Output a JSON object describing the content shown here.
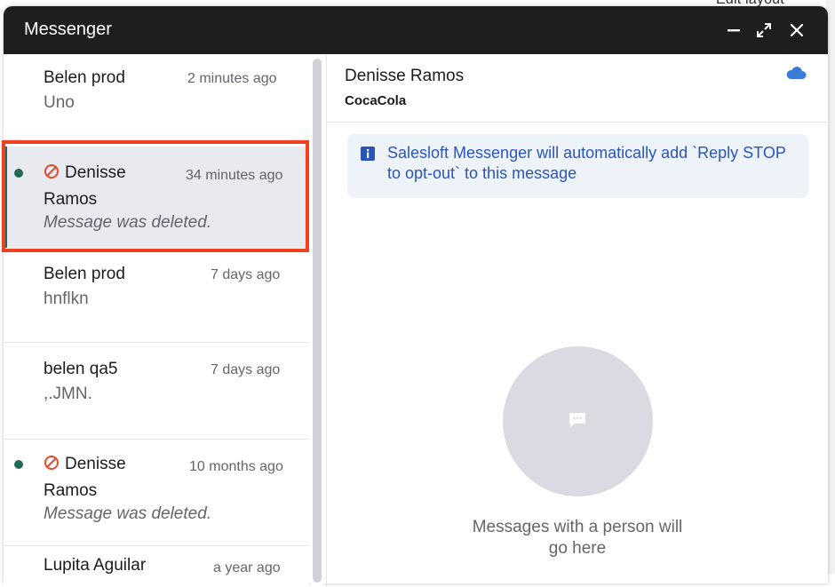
{
  "background": {
    "peek_text": "Edit layout"
  },
  "window": {
    "title": "Messenger"
  },
  "conversations": [
    {
      "name": "Belen prod",
      "time": "2 minutes ago",
      "preview": "Uno"
    },
    {
      "name": "Denisse Ramos",
      "time": "34 minutes ago",
      "preview": "Message was deleted.",
      "unread": true,
      "opted_out": true,
      "selected": true
    },
    {
      "name": "Belen prod",
      "time": "7 days ago",
      "preview": "hnflkn"
    },
    {
      "name": "belen qa5",
      "time": "7 days ago",
      "preview": ",.JMN."
    },
    {
      "name": "Denisse Ramos",
      "time": "10 months ago",
      "preview": "Message was deleted.",
      "unread": true,
      "opted_out": true
    },
    {
      "name": "Lupita Aguilar",
      "time": "a year ago"
    }
  ],
  "detail": {
    "name": "Denisse Ramos",
    "company": "CocaCola",
    "notice": "Salesloft Messenger will automatically add `Reply STOP to opt-out` to this message",
    "empty_state": "Messages with a person will go here"
  },
  "colors": {
    "accent": "#236857",
    "highlight": "#f0401d",
    "notice_text": "#2a55b8",
    "cloud": "#3a7bd5"
  },
  "icons": {
    "minimize": "minimize-icon",
    "expand": "expand-icon",
    "close": "close-icon",
    "cloud": "cloud-icon",
    "info": "info-icon",
    "ban": "ban-icon",
    "chat": "chat-bubble-icon"
  }
}
